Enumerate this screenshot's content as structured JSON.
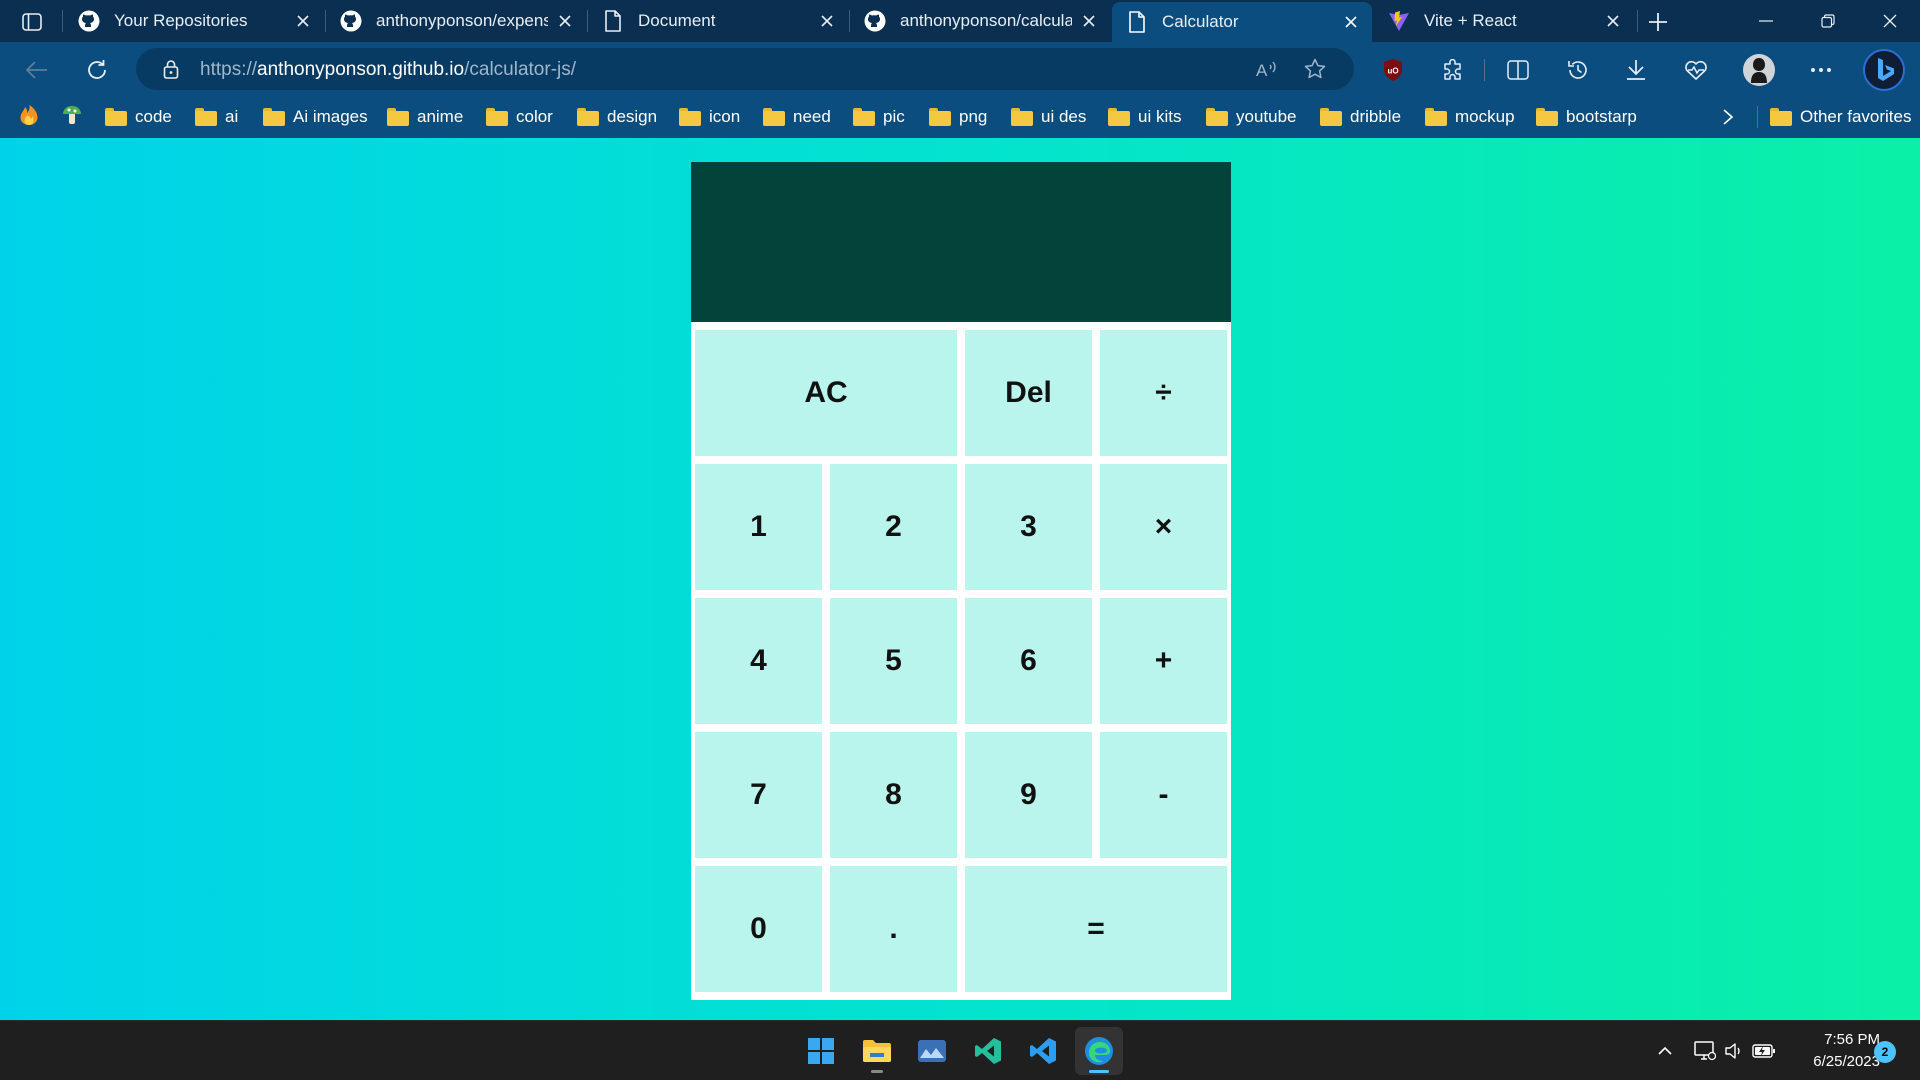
{
  "browser": {
    "tabs": [
      {
        "title": "Your Repositories",
        "icon": "github-icon",
        "active": false
      },
      {
        "title": "anthonyponson/expense",
        "icon": "github-icon",
        "active": false
      },
      {
        "title": "Document",
        "icon": "page-icon",
        "active": false
      },
      {
        "title": "anthonyponson/calculat",
        "icon": "github-icon",
        "active": false
      },
      {
        "title": "Calculator",
        "icon": "page-icon",
        "active": true
      },
      {
        "title": "Vite + React",
        "icon": "vite-icon",
        "active": false
      }
    ],
    "address": {
      "protocol": "https://",
      "host": "anthonyponson.github.io",
      "path": "/calculator-js/"
    },
    "favorites": [
      {
        "label": "",
        "icon": "flame-icon"
      },
      {
        "label": "",
        "icon": "mushroom-icon"
      },
      {
        "label": "code",
        "icon": "folder-icon"
      },
      {
        "label": "ai",
        "icon": "folder-icon"
      },
      {
        "label": "Ai images",
        "icon": "folder-icon"
      },
      {
        "label": "anime",
        "icon": "folder-icon"
      },
      {
        "label": "color",
        "icon": "folder-icon"
      },
      {
        "label": "design",
        "icon": "folder-icon"
      },
      {
        "label": "icon",
        "icon": "folder-icon"
      },
      {
        "label": "need",
        "icon": "folder-icon"
      },
      {
        "label": "pic",
        "icon": "folder-icon"
      },
      {
        "label": "png",
        "icon": "folder-icon"
      },
      {
        "label": "ui des",
        "icon": "folder-icon"
      },
      {
        "label": "ui kits",
        "icon": "folder-icon"
      },
      {
        "label": "youtube",
        "icon": "folder-icon"
      },
      {
        "label": "dribble",
        "icon": "folder-icon"
      },
      {
        "label": "mockup",
        "icon": "folder-icon"
      },
      {
        "label": "bootstarp",
        "icon": "folder-icon"
      }
    ],
    "other_favorites": "Other favorites"
  },
  "calculator": {
    "display": "",
    "keys": [
      "AC",
      "Del",
      "÷",
      "1",
      "2",
      "3",
      "×",
      "4",
      "5",
      "6",
      "+",
      "7",
      "8",
      "9",
      "-",
      "0",
      ".",
      "="
    ]
  },
  "taskbar": {
    "apps": [
      "windows-start-icon",
      "file-explorer-icon",
      "photos-icon",
      "visual-studio-code-insiders-icon",
      "visual-studio-code-icon",
      "microsoft-edge-icon"
    ],
    "time": "7:56 PM",
    "date": "6/25/2023",
    "notifications": "2"
  },
  "colors": {
    "page_gradient_start": "#00d3e9",
    "page_gradient_end": "#0af0a6",
    "calc_display": "#02443a",
    "calc_key": "#b9f5ec",
    "browser_chrome": "#0b4d7e"
  }
}
